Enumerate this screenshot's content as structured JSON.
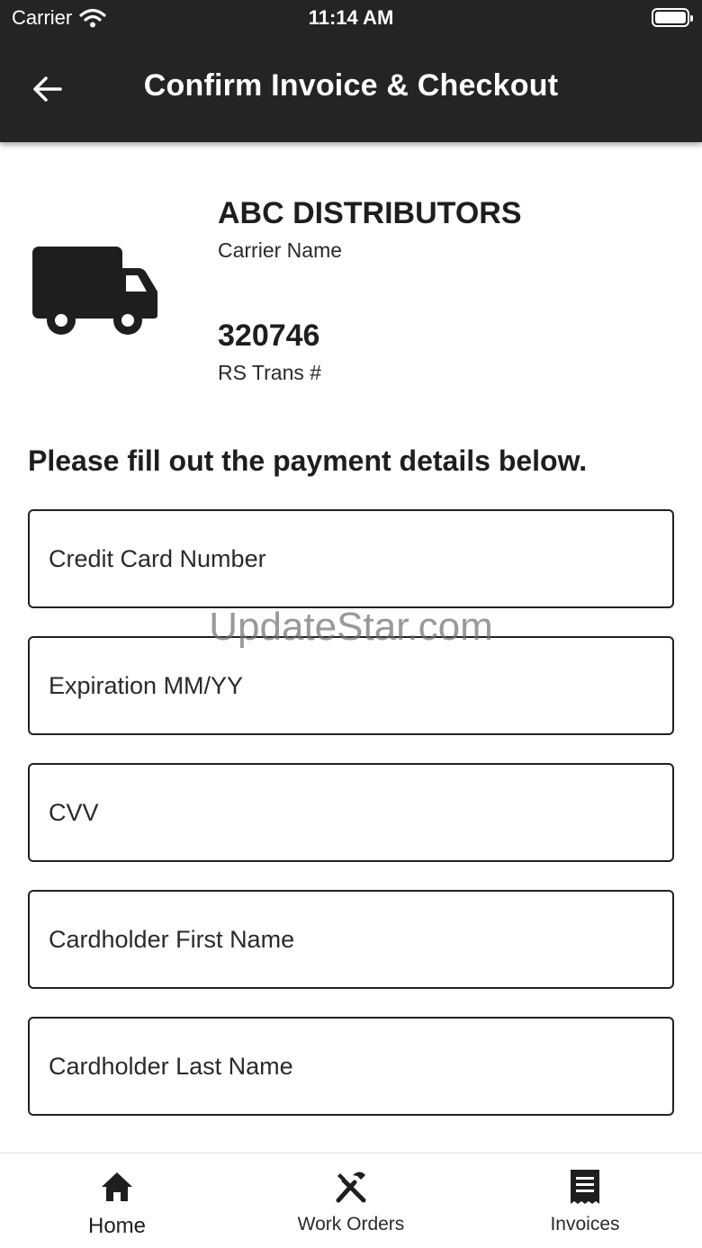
{
  "status_bar": {
    "carrier": "Carrier",
    "time": "11:14 AM"
  },
  "header": {
    "title": "Confirm Invoice & Checkout",
    "back_icon": "arrow-left-icon"
  },
  "carrier_info": {
    "name": "ABC DISTRIBUTORS",
    "name_label": "Carrier Name",
    "trans_number": "320746",
    "trans_label": "RS Trans #",
    "icon": "truck-icon"
  },
  "instructions": "Please fill out the payment details below.",
  "form": {
    "card_number": {
      "placeholder": "Credit Card Number",
      "value": ""
    },
    "expiration": {
      "placeholder": "Expiration MM/YY",
      "value": ""
    },
    "cvv": {
      "placeholder": "CVV",
      "value": ""
    },
    "first_name": {
      "placeholder": "Cardholder First Name",
      "value": ""
    },
    "last_name": {
      "placeholder": "Cardholder Last Name",
      "value": ""
    }
  },
  "watermark": "UpdateStar.com",
  "tabbar": {
    "tabs": [
      {
        "label": "Home",
        "icon": "home-icon",
        "active": true
      },
      {
        "label": "Work Orders",
        "icon": "tools-icon",
        "active": false
      },
      {
        "label": "Invoices",
        "icon": "invoice-icon",
        "active": false
      }
    ]
  },
  "colors": {
    "header_bg": "#242424",
    "text": "#1e1e1e",
    "border": "#222222"
  }
}
